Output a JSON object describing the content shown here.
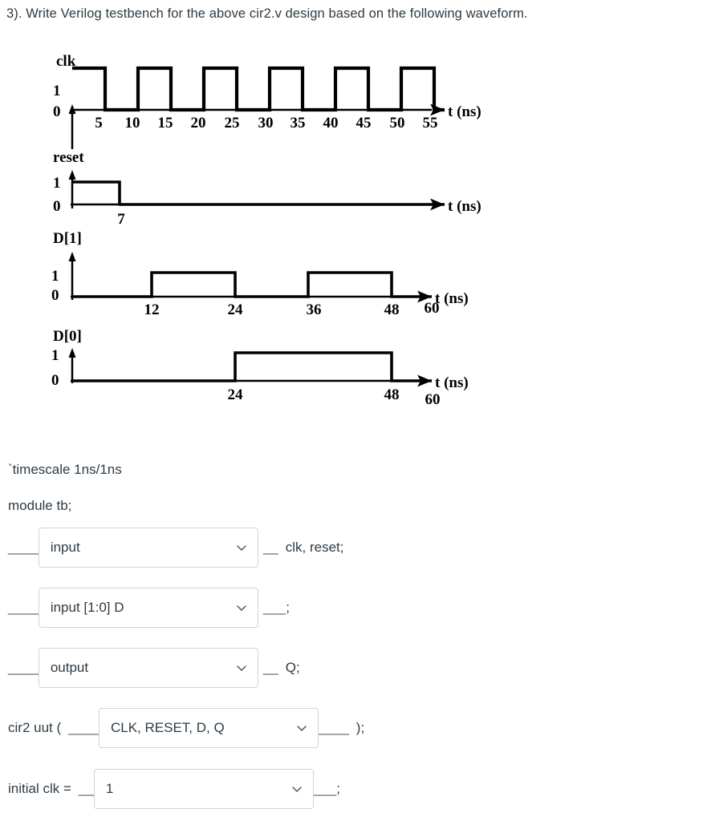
{
  "question": {
    "prompt": "3).  Write Verilog testbench for the above cir2.v design based on the following waveform."
  },
  "waveform": {
    "axis_label": "t (ns)",
    "high_label": "1",
    "low_label": "0",
    "signals": [
      {
        "name": "clk",
        "ticks": [
          "5",
          "10",
          "15",
          "20",
          "25",
          "30",
          "35",
          "40",
          "45",
          "50",
          "55"
        ],
        "tick_values": [
          5,
          10,
          15,
          20,
          25,
          30,
          35,
          40,
          45,
          50,
          55
        ],
        "transitions": [
          0,
          5,
          10,
          15,
          20,
          25,
          30,
          35,
          40,
          45,
          50,
          55
        ],
        "initial_level": 1,
        "t_end": 60
      },
      {
        "name": "reset",
        "ticks": [
          "7"
        ],
        "tick_values": [
          7
        ],
        "transitions": [
          0,
          7
        ],
        "initial_level": 1,
        "t_end": 60
      },
      {
        "name": "D[1]",
        "ticks": [
          "12",
          "24",
          "36",
          "48",
          "60"
        ],
        "tick_values": [
          12,
          24,
          36,
          48,
          60
        ],
        "transitions": [
          12,
          24,
          36,
          48
        ],
        "initial_level": 0,
        "t_end": 60
      },
      {
        "name": "D[0]",
        "ticks": [
          "24",
          "48",
          "60"
        ],
        "tick_values": [
          24,
          48,
          60
        ],
        "transitions": [
          24,
          48
        ],
        "initial_level": 0,
        "t_end": 60
      }
    ]
  },
  "code": {
    "timescale": "`timescale 1ns/1ns",
    "module_decl": "module tb;",
    "lines": [
      {
        "id": "line-reg-clk-reset",
        "lead_blank": "____",
        "dropdown_value": "input",
        "trail_blank": "__",
        "trail_text": "clk, reset;"
      },
      {
        "id": "line-reg-d",
        "lead_blank": "____",
        "dropdown_value": "input [1:0] D",
        "trail_blank": "___",
        "trail_text": ";"
      },
      {
        "id": "line-wire-q",
        "lead_blank": "____",
        "dropdown_value": "output",
        "trail_blank": "__",
        "trail_text": "Q;"
      }
    ],
    "instantiation": {
      "prefix": "cir2  uut (",
      "lead_blank": "____",
      "dropdown_value": "CLK, RESET, D, Q",
      "trail_blank": "____",
      "suffix": ");"
    },
    "initial_clk": {
      "prefix": "initial  clk =",
      "lead_blank": "__",
      "dropdown_value": "1",
      "trail_blank": "___",
      "suffix": ";"
    }
  },
  "icons": {
    "chevron_down": "chevron-down-icon"
  },
  "colors": {
    "text": "#2d3b45",
    "border": "#d0d5da",
    "waveform": "#000000",
    "background": "#ffffff"
  }
}
